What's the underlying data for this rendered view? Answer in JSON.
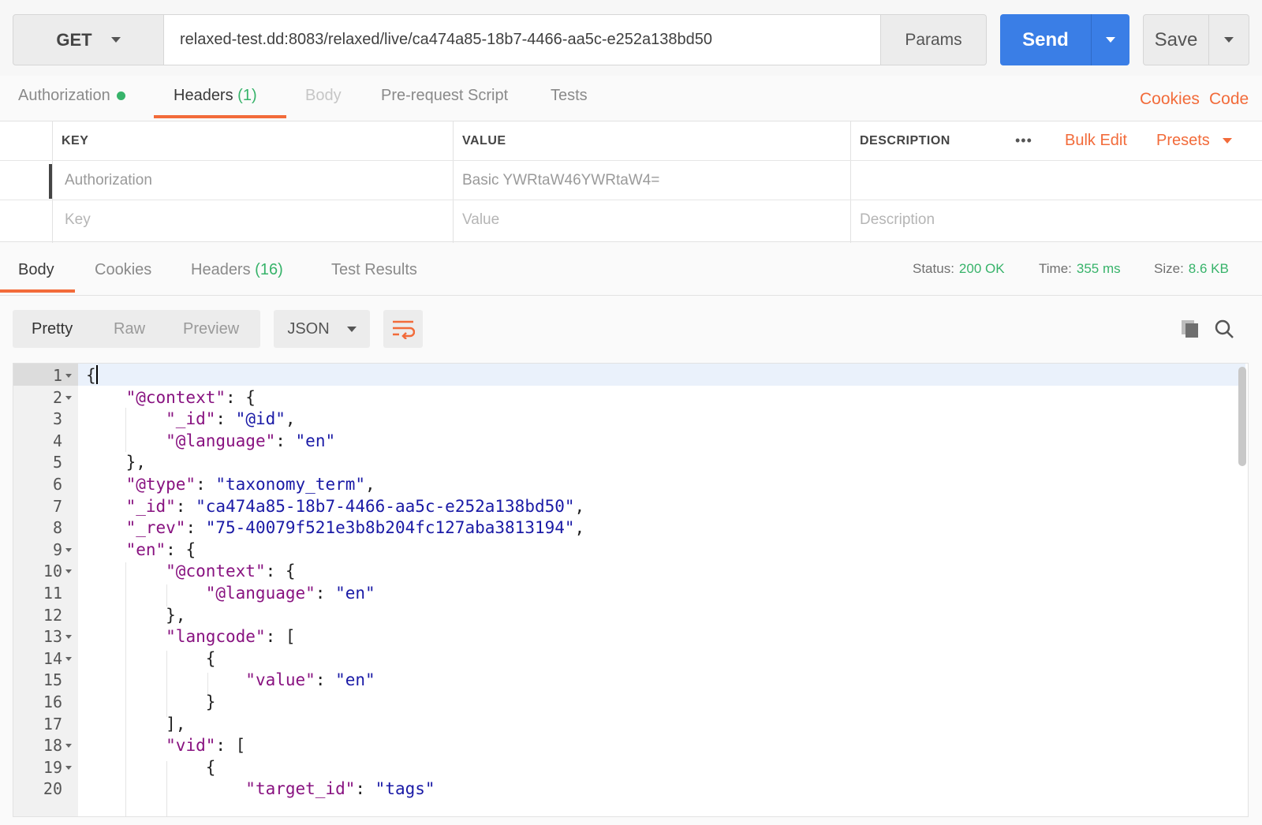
{
  "request": {
    "method": "GET",
    "url": "relaxed-test.dd:8083/relaxed/live/ca474a85-18b7-4466-aa5c-e252a138bd50",
    "params_label": "Params",
    "send_label": "Send",
    "save_label": "Save"
  },
  "request_tabs": {
    "authorization": "Authorization",
    "headers": "Headers",
    "headers_count": "(1)",
    "body": "Body",
    "prerequest": "Pre-request Script",
    "tests": "Tests",
    "cookies": "Cookies",
    "code": "Code"
  },
  "headers_table": {
    "col_key": "KEY",
    "col_value": "VALUE",
    "col_description": "DESCRIPTION",
    "more": "•••",
    "bulk_edit": "Bulk Edit",
    "presets": "Presets",
    "rows": [
      {
        "key": "Authorization",
        "value": "Basic YWRtaW46YWRtaW4=",
        "description": ""
      }
    ],
    "placeholders": {
      "key": "Key",
      "value": "Value",
      "description": "Description"
    }
  },
  "response_tabs": {
    "body": "Body",
    "cookies": "Cookies",
    "headers": "Headers",
    "headers_count": "(16)",
    "test_results": "Test Results"
  },
  "response_meta": {
    "status_label": "Status:",
    "status_value": "200 OK",
    "time_label": "Time:",
    "time_value": "355 ms",
    "size_label": "Size:",
    "size_value": "8.6 KB"
  },
  "response_toolbar": {
    "pretty": "Pretty",
    "raw": "Raw",
    "preview": "Preview",
    "format": "JSON"
  },
  "code_lines": [
    {
      "n": "1",
      "text": "{"
    },
    {
      "n": "2",
      "text": "    \"@context\": {"
    },
    {
      "n": "3",
      "text": "        \"_id\": \"@id\","
    },
    {
      "n": "4",
      "text": "        \"@language\": \"en\""
    },
    {
      "n": "5",
      "text": "    },"
    },
    {
      "n": "6",
      "text": "    \"@type\": \"taxonomy_term\","
    },
    {
      "n": "7",
      "text": "    \"_id\": \"ca474a85-18b7-4466-aa5c-e252a138bd50\","
    },
    {
      "n": "8",
      "text": "    \"_rev\": \"75-40079f521e3b8b204fc127aba3813194\","
    },
    {
      "n": "9",
      "text": "    \"en\": {"
    },
    {
      "n": "10",
      "text": "        \"@context\": {"
    },
    {
      "n": "11",
      "text": "            \"@language\": \"en\""
    },
    {
      "n": "12",
      "text": "        },"
    },
    {
      "n": "13",
      "text": "        \"langcode\": ["
    },
    {
      "n": "14",
      "text": "            {"
    },
    {
      "n": "15",
      "text": "                \"value\": \"en\""
    },
    {
      "n": "16",
      "text": "            }"
    },
    {
      "n": "17",
      "text": "        ],"
    },
    {
      "n": "18",
      "text": "        \"vid\": ["
    },
    {
      "n": "19",
      "text": "            {"
    },
    {
      "n": "20",
      "text": "                \"target_id\": \"tags\""
    }
  ],
  "colors": {
    "accent": "#f26b3a",
    "send": "#3a7ee6",
    "success": "#37b36a",
    "json_key": "#881280",
    "json_string": "#1a1aa6"
  },
  "icons": [
    "chevron-down-icon",
    "green-dot-icon",
    "wrap-lines-icon",
    "copy-icon",
    "search-icon"
  ]
}
